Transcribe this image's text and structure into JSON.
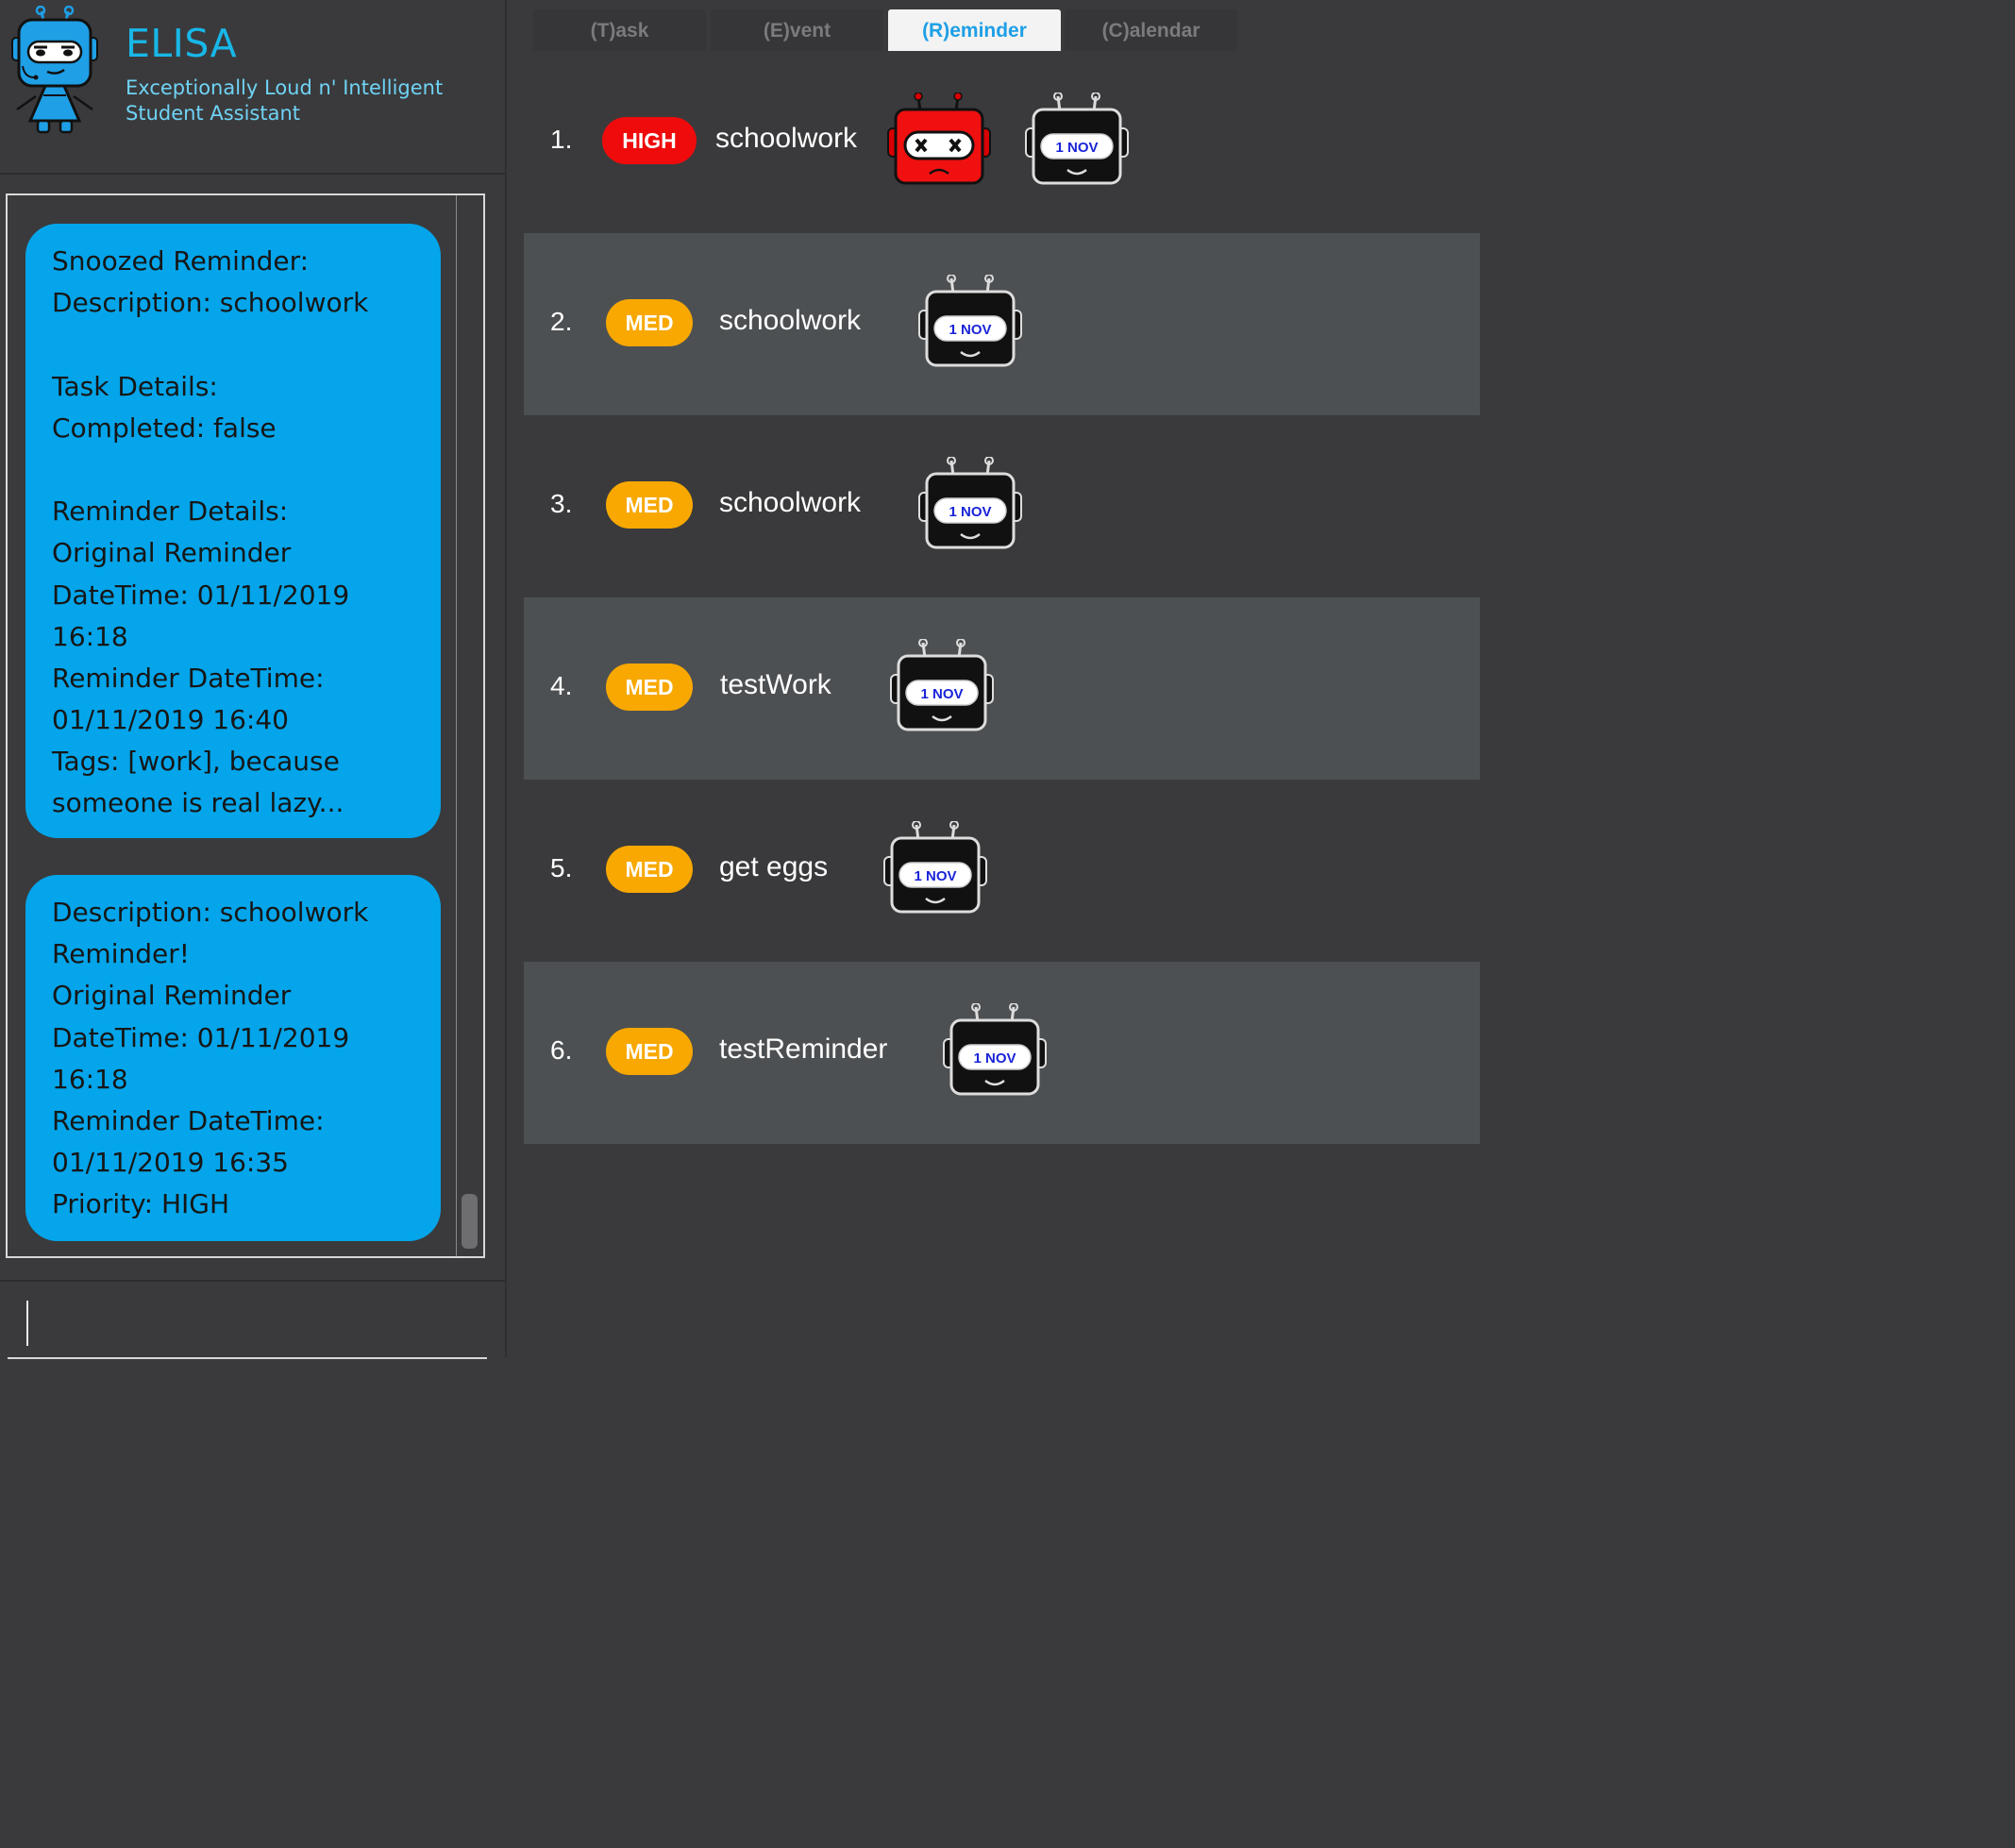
{
  "app": {
    "title": "ELISA",
    "subtitle_line1": "Exceptionally Loud n' Intelligent",
    "subtitle_line2": "Student Assistant"
  },
  "chat": {
    "bubble1": [
      "Snoozed Reminder:",
      "Description: schoolwork",
      "",
      "Task Details:",
      "Completed: false",
      "",
      "Reminder Details:",
      "Original Reminder",
      "DateTime: 01/11/2019",
      "16:18",
      "Reminder DateTime:",
      "01/11/2019 16:40",
      "Tags: [work], because",
      "someone is real lazy..."
    ],
    "bubble2": [
      "Description: schoolwork",
      "Reminder!",
      "Original Reminder",
      "DateTime: 01/11/2019",
      "16:18",
      "Reminder DateTime:",
      "01/11/2019 16:35",
      "Priority: HIGH"
    ]
  },
  "command_input": {
    "value": ""
  },
  "tabs": [
    {
      "label": "(T)ask",
      "active": false
    },
    {
      "label": "(E)vent",
      "active": false
    },
    {
      "label": "(R)eminder",
      "active": true
    },
    {
      "label": "(C)alendar",
      "active": false
    }
  ],
  "reminders": [
    {
      "index": "1.",
      "priority": "HIGH",
      "description": "schoolwork",
      "overdue": true,
      "date_badge": "1 NOV"
    },
    {
      "index": "2.",
      "priority": "MED",
      "description": "schoolwork",
      "overdue": false,
      "date_badge": "1 NOV"
    },
    {
      "index": "3.",
      "priority": "MED",
      "description": "schoolwork",
      "overdue": false,
      "date_badge": "1 NOV"
    },
    {
      "index": "4.",
      "priority": "MED",
      "description": "testWork",
      "overdue": false,
      "date_badge": "1 NOV"
    },
    {
      "index": "5.",
      "priority": "MED",
      "description": "get eggs",
      "overdue": false,
      "date_badge": "1 NOV"
    },
    {
      "index": "6.",
      "priority": "MED",
      "description": "testReminder",
      "overdue": false,
      "date_badge": "1 NOV"
    }
  ],
  "colors": {
    "accent": "#1e9fe6",
    "bubble": "#04a5ea",
    "priority_high": "#ef0b0b",
    "priority_med": "#f8a800",
    "row_light": "#4d5052",
    "row_dark": "#3a3a3c"
  },
  "icons": {
    "logo": "elisa-robot-logo-icon",
    "overdue": "sad-red-robot-icon",
    "date": "calendar-robot-icon"
  }
}
